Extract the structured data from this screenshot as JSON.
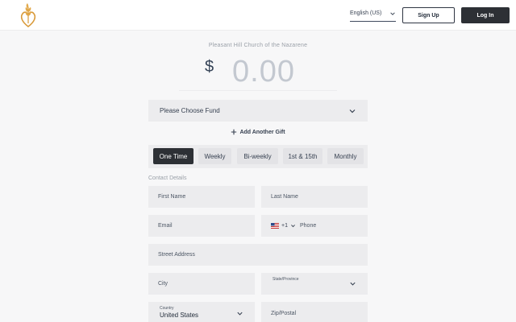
{
  "header": {
    "language": "English (US)",
    "signup_label": "Sign Up",
    "login_label": "Log In"
  },
  "giving": {
    "church_name": "Pleasant Hill Church of the Nazarene",
    "currency_symbol": "$",
    "amount_placeholder": "0.00",
    "fund_placeholder": "Please Choose Fund",
    "add_gift_label": "Add Another Gift"
  },
  "frequency": {
    "options": [
      "One Time",
      "Weekly",
      "Bi-weekly",
      "1st & 15th",
      "Monthly"
    ],
    "selected": "One Time"
  },
  "contact": {
    "section_label": "Contact Details",
    "first_name": "First Name",
    "last_name": "Last Name",
    "email": "Email",
    "country_code": "+1",
    "phone": "Phone",
    "street": "Street Address",
    "city": "City",
    "state_label": "State/Province",
    "country_label": "Country",
    "country_value": "United States",
    "zip": "Zip/Postal"
  },
  "colors": {
    "primary_dark": "#2d3035",
    "logo_gold": "#d99a3a",
    "field_bg": "#ececee"
  }
}
